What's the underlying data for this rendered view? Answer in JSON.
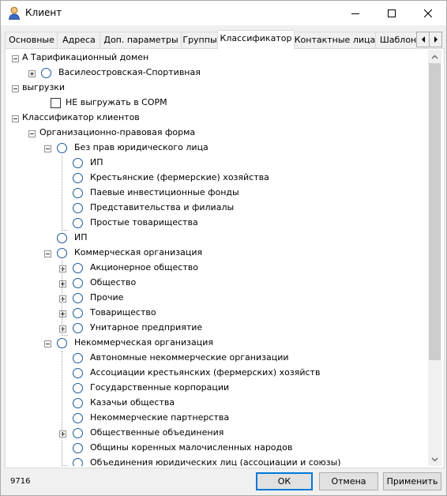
{
  "window": {
    "title": "Клиент",
    "icon": "user-icon"
  },
  "tabs": [
    {
      "label": "Основные"
    },
    {
      "label": "Адреса"
    },
    {
      "label": "Доп. параметры"
    },
    {
      "label": "Группы"
    },
    {
      "label": "Классификатор"
    },
    {
      "label": "Контактные лица"
    },
    {
      "label": "Шаблоны"
    }
  ],
  "active_tab": "Классификатор",
  "tree": [
    {
      "label": "А Тарификационный домен",
      "level": 0,
      "expander": "minus",
      "marker": "none"
    },
    {
      "label": "Василеостровская-Спортивная",
      "level": 1,
      "expander": "plus",
      "marker": "radio"
    },
    {
      "label": "выгрузки",
      "level": 0,
      "expander": "minus",
      "marker": "none"
    },
    {
      "label": "НЕ выгружать в СОРМ",
      "level": 1,
      "expander": "none",
      "marker": "checkbox"
    },
    {
      "label": "Классификатор клиентов",
      "level": 0,
      "expander": "minus",
      "marker": "none"
    },
    {
      "label": "Организационно-правовая форма",
      "level": 1,
      "expander": "minus",
      "marker": "none"
    },
    {
      "label": "Без прав юридического лица",
      "level": 2,
      "expander": "minus",
      "marker": "radio"
    },
    {
      "label": "ИП",
      "level": 3,
      "expander": "none",
      "marker": "radio"
    },
    {
      "label": "Крестьянские (фермерские) хозяйства",
      "level": 3,
      "expander": "none",
      "marker": "radio"
    },
    {
      "label": "Паевые инвестиционные фонды",
      "level": 3,
      "expander": "none",
      "marker": "radio"
    },
    {
      "label": "Представительства и филиалы",
      "level": 3,
      "expander": "none",
      "marker": "radio"
    },
    {
      "label": "Простые товарищества",
      "level": 3,
      "expander": "none",
      "marker": "radio"
    },
    {
      "label": "ИП",
      "level": 2,
      "expander": "none",
      "marker": "radio"
    },
    {
      "label": "Коммерческая организация",
      "level": 2,
      "expander": "minus",
      "marker": "radio"
    },
    {
      "label": "Акционерное общество",
      "level": 3,
      "expander": "plus",
      "marker": "radio"
    },
    {
      "label": "Общество",
      "level": 3,
      "expander": "plus",
      "marker": "radio"
    },
    {
      "label": "Прочие",
      "level": 3,
      "expander": "plus",
      "marker": "radio"
    },
    {
      "label": "Товарищество",
      "level": 3,
      "expander": "plus",
      "marker": "radio"
    },
    {
      "label": "Унитарное предприятие",
      "level": 3,
      "expander": "plus",
      "marker": "radio"
    },
    {
      "label": "Некоммерческая организация",
      "level": 2,
      "expander": "minus",
      "marker": "radio"
    },
    {
      "label": "Автономные некоммерческие организации",
      "level": 3,
      "expander": "none",
      "marker": "radio"
    },
    {
      "label": "Ассоциации крестьянских (фермерских) хозяйств",
      "level": 3,
      "expander": "none",
      "marker": "radio"
    },
    {
      "label": "Государственные корпорации",
      "level": 3,
      "expander": "none",
      "marker": "radio"
    },
    {
      "label": "Казачьи общества",
      "level": 3,
      "expander": "none",
      "marker": "radio"
    },
    {
      "label": "Некоммерческие партнерства",
      "level": 3,
      "expander": "none",
      "marker": "radio"
    },
    {
      "label": "Общественные объединения",
      "level": 3,
      "expander": "plus",
      "marker": "radio"
    },
    {
      "label": "Общины коренных малочисленных народов",
      "level": 3,
      "expander": "none",
      "marker": "radio"
    },
    {
      "label": "Объединения юридических лиц (ассоциации и союзы)",
      "level": 3,
      "expander": "none",
      "marker": "radio"
    }
  ],
  "footer": {
    "count": "9716",
    "ok_label": "ОК",
    "cancel_label": "Отмена",
    "apply_label": "Применить"
  }
}
